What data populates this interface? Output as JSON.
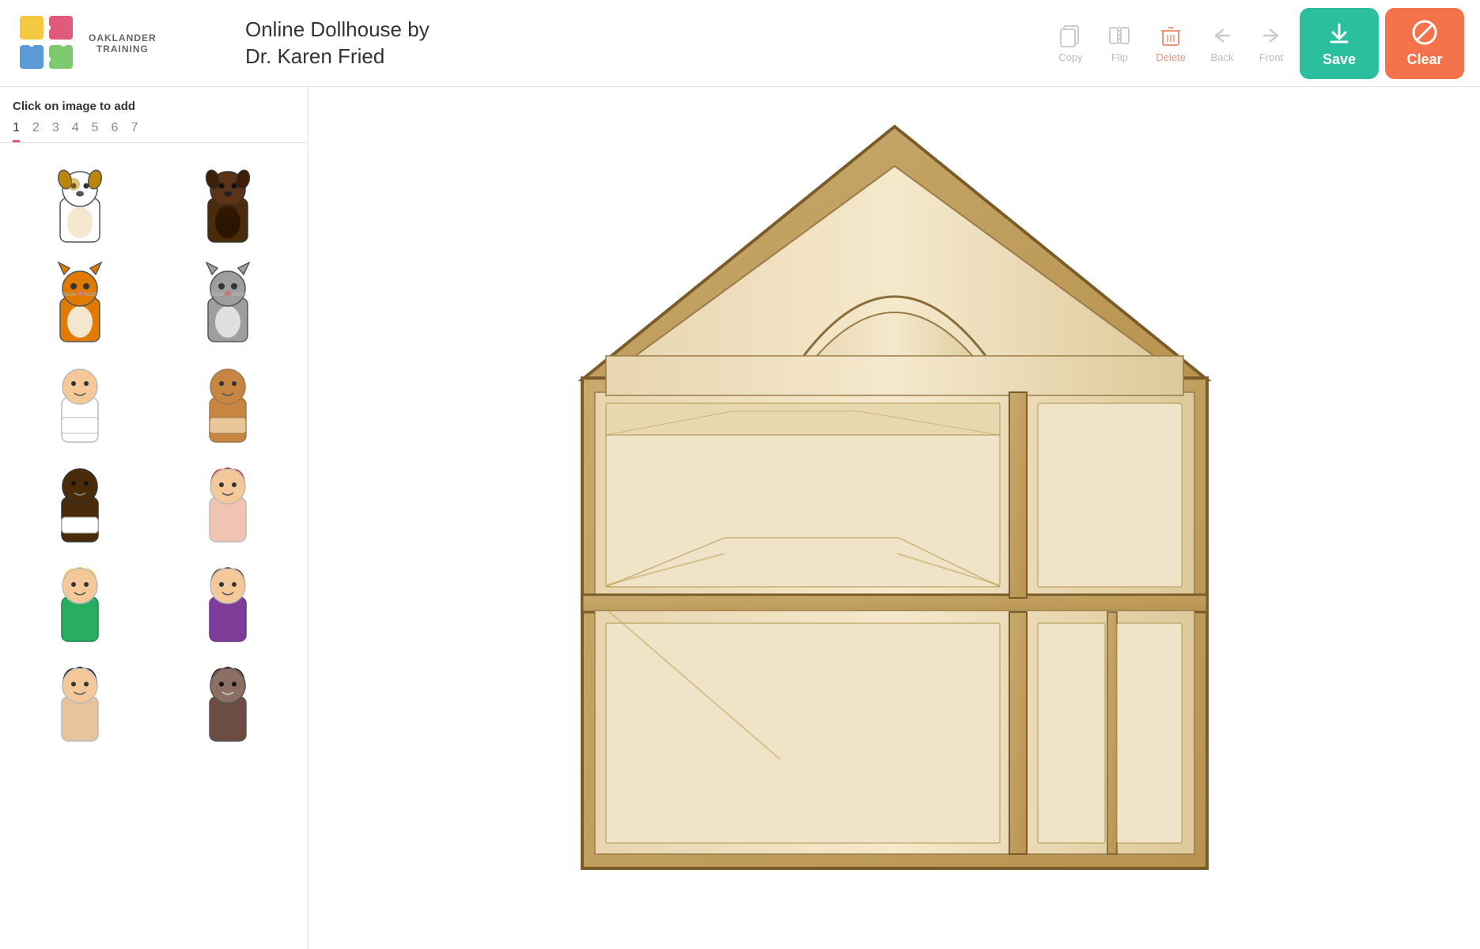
{
  "header": {
    "logo_text": "OAKLANDER\nTRAINING",
    "app_title_line1": "Online Dollhouse by",
    "app_title_line2": "Dr. Karen Fried"
  },
  "toolbar": {
    "copy_label": "Copy",
    "flip_label": "Flip",
    "delete_label": "Delete",
    "back_label": "Back",
    "front_label": "Front",
    "save_label": "Save",
    "clear_label": "Clear"
  },
  "sidebar": {
    "instruction_bold": "Click",
    "instruction_rest": " on image to add",
    "tabs": [
      "1",
      "2",
      "3",
      "4",
      "5",
      "6",
      "7"
    ],
    "active_tab": 0
  },
  "colors": {
    "save_bg": "#2bbfa0",
    "clear_bg": "#f4734a",
    "tab_active_border": "#e05a7a"
  }
}
